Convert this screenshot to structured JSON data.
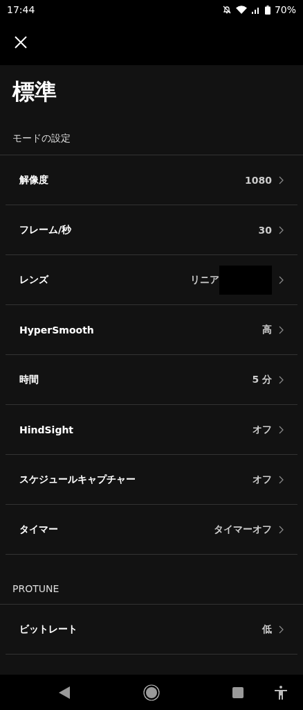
{
  "status_bar": {
    "time": "17:44",
    "battery": "70%"
  },
  "title": "標準",
  "sections": [
    {
      "heading": "モードの設定",
      "rows": [
        {
          "label": "解像度",
          "value": "1080",
          "redacted": false
        },
        {
          "label": "フレーム/秒",
          "value": "30",
          "redacted": false
        },
        {
          "label": "レンズ",
          "value": "リニア",
          "redacted": true
        },
        {
          "label": "HyperSmooth",
          "value": "高",
          "redacted": false
        },
        {
          "label": "時間",
          "value": "5 分",
          "redacted": false
        },
        {
          "label": "HindSight",
          "value": "オフ",
          "redacted": false
        },
        {
          "label": "スケジュールキャプチャー",
          "value": "オフ",
          "redacted": false
        },
        {
          "label": "タイマー",
          "value": "タイマーオフ",
          "redacted": false
        }
      ]
    },
    {
      "heading": "PROTUNE",
      "rows": [
        {
          "label": "ビットレート",
          "value": "低",
          "redacted": false
        }
      ]
    }
  ]
}
